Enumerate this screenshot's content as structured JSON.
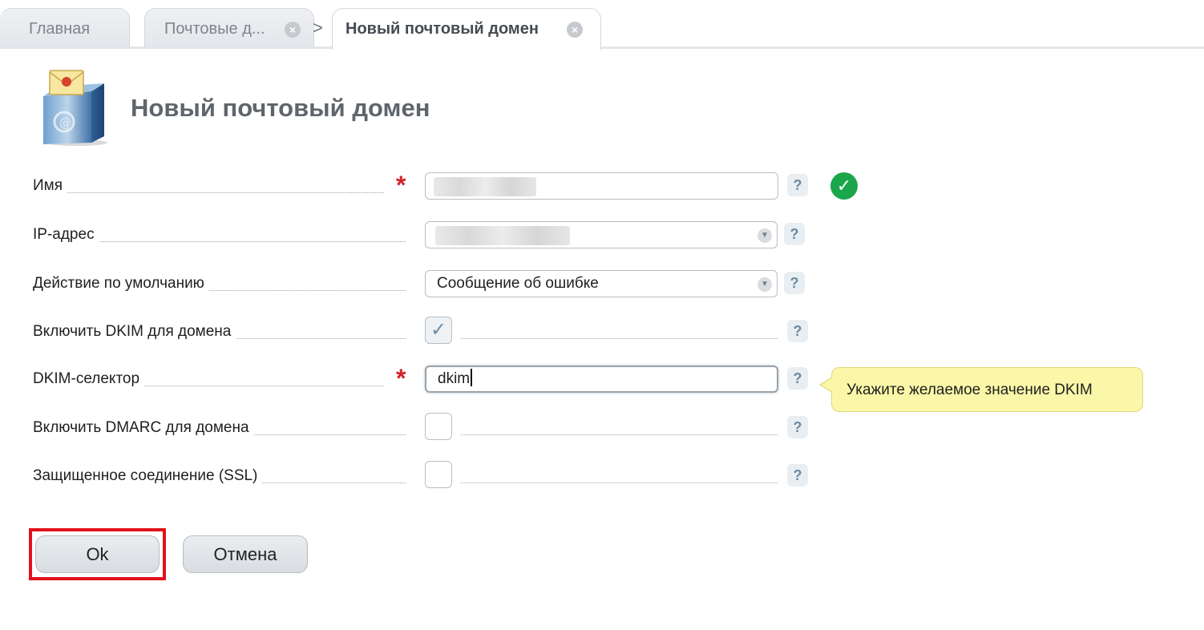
{
  "tabs": [
    {
      "label": "Главная",
      "active": false,
      "closable": false
    },
    {
      "label": "Почтовые д...",
      "active": false,
      "closable": true
    },
    {
      "label": "Новый почтовый домен",
      "active": true,
      "closable": true
    }
  ],
  "breadcrumb_separator": ">",
  "page": {
    "icon": "mail-domain-icon",
    "title": "Новый почтовый домен"
  },
  "form": {
    "fields": [
      {
        "label": "Имя",
        "type": "text",
        "required": true,
        "value": "",
        "value_obscured": true,
        "valid": true
      },
      {
        "label": "IP-адрес",
        "type": "select",
        "required": false,
        "value": "",
        "value_obscured": true
      },
      {
        "label": "Действие по умолчанию",
        "type": "select",
        "required": false,
        "value": "Сообщение об ошибке"
      },
      {
        "label": "Включить DKIM для домена",
        "type": "checkbox",
        "checked": true
      },
      {
        "label": "DKIM-селектор",
        "type": "text",
        "required": true,
        "value": "dkim",
        "focused": true
      },
      {
        "label": "Включить DMARC для домена",
        "type": "checkbox",
        "checked": false
      },
      {
        "label": "Защищенное соединение (SSL)",
        "type": "checkbox",
        "checked": false
      }
    ],
    "required_mark": "*",
    "help_mark": "?",
    "tooltip": "Укажите желаемое значение DKIM"
  },
  "buttons": {
    "ok": "Ok",
    "cancel": "Отмена"
  },
  "colors": {
    "required": "#d4232a",
    "valid": "#1aa64a",
    "tooltip_bg": "#fbf7a8",
    "highlight_frame": "#e0121b"
  }
}
